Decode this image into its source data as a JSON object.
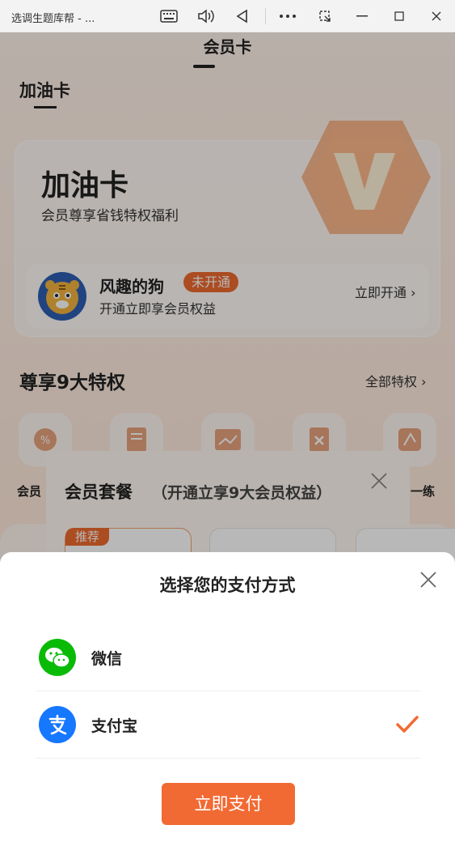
{
  "window": {
    "title": "选调生题库帮 - ..."
  },
  "app": {
    "top_tab": "会员卡",
    "section_title": "加油卡",
    "card": {
      "title": "加油卡",
      "subtitle": "会员尊享省钱特权福利",
      "user": {
        "name": "风趣的狗",
        "status_badge": "未开通",
        "desc": "开通立即享会员权益",
        "action": "立即开通"
      }
    },
    "privileges": {
      "title": "尊享9大特权",
      "all_link": "全部特权",
      "labels": [
        "会员",
        "一练"
      ]
    },
    "package": {
      "title": "会员套餐",
      "subtitle": "（开通立享9大会员权益）",
      "recommend_badge": "推荐"
    }
  },
  "payment_sheet": {
    "title": "选择您的支付方式",
    "methods": [
      {
        "name": "微信",
        "icon": "wechat-icon",
        "color": "#09bb07",
        "selected": false
      },
      {
        "name": "支付宝",
        "icon": "alipay-icon",
        "color": "#1677ff",
        "selected": true
      }
    ],
    "pay_button": "立即支付",
    "accent_color": "#f26a33"
  }
}
